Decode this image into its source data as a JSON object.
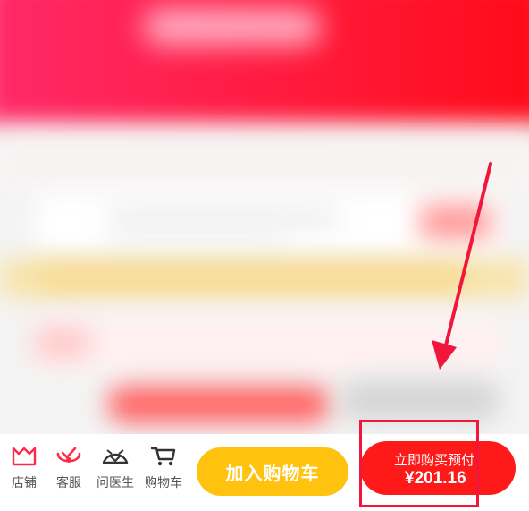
{
  "colors": {
    "brand_red": "#ff1a1a",
    "cart_yellow": "#ffc20e",
    "annotation_red": "#f0163c"
  },
  "bottom_bar": {
    "nav": [
      {
        "label": "店铺",
        "icon": "shop-icon"
      },
      {
        "label": "客服",
        "icon": "customer-service-icon"
      },
      {
        "label": "问医生",
        "icon": "doctor-icon"
      },
      {
        "label": "购物车",
        "icon": "cart-icon"
      }
    ],
    "add_to_cart_label": "加入购物车",
    "buy_now_label": "立即购买预付",
    "buy_now_price": "¥201.16"
  }
}
